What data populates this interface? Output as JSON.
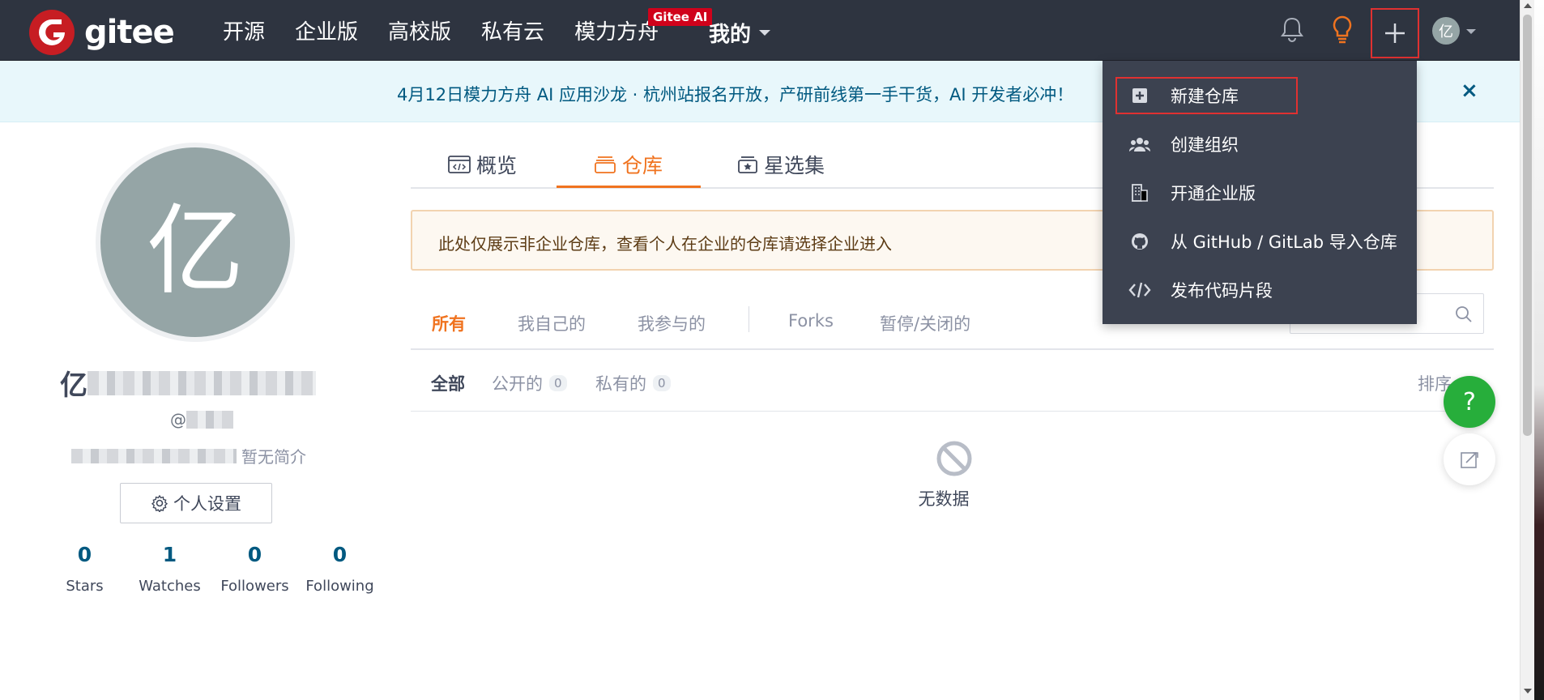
{
  "brand": {
    "name": "gitee"
  },
  "nav": {
    "links": [
      "开源",
      "企业版",
      "高校版",
      "私有云",
      "模力方舟"
    ],
    "ai_badge": "Gitee AI",
    "mine_label": "我的"
  },
  "user": {
    "avatar_char": "亿"
  },
  "announcement": {
    "text": "4月12日模力方舟 AI 应用沙龙 · 杭州站报名开放，产研前线第一手干货，AI 开发者必冲！",
    "close": "×"
  },
  "profile": {
    "name_prefix": "亿",
    "handle_prefix": "@",
    "bio": "暂无简介",
    "settings_label": "个人设置",
    "stats": [
      {
        "count": "0",
        "label": "Stars"
      },
      {
        "count": "1",
        "label": "Watches"
      },
      {
        "count": "0",
        "label": "Followers"
      },
      {
        "count": "0",
        "label": "Following"
      }
    ]
  },
  "tabs": [
    {
      "label": "概览",
      "icon": "code-window-icon"
    },
    {
      "label": "仓库",
      "icon": "repo-icon",
      "active": true
    },
    {
      "label": "星选集",
      "icon": "star-collection-icon"
    }
  ],
  "notice": "此处仅展示非企业仓库，查看个人在企业的仓库请选择企业进入",
  "filters": [
    "所有",
    "我自己的",
    "我参与的",
    "Forks",
    "暂停/关闭的"
  ],
  "sub_filters": {
    "all": "全部",
    "public": "公开的",
    "public_count": "0",
    "private": "私有的",
    "private_count": "0",
    "sort": "排序"
  },
  "empty_text": "无数据",
  "fab": {
    "help": "?"
  },
  "dropdown": {
    "items": [
      {
        "label": "新建仓库",
        "icon": "plus-square-icon"
      },
      {
        "label": "创建组织",
        "icon": "users-icon"
      },
      {
        "label": "开通企业版",
        "icon": "building-icon"
      },
      {
        "label": "从 GitHub / GitLab 导入仓库",
        "icon": "github-icon"
      },
      {
        "label": "发布代码片段",
        "icon": "code-icon"
      }
    ]
  },
  "colors": {
    "nav_bg": "#2e3440",
    "accent": "#f0731f",
    "brand_red": "#c71d23",
    "highlight_border": "#e03131",
    "link_blue": "#005980"
  }
}
